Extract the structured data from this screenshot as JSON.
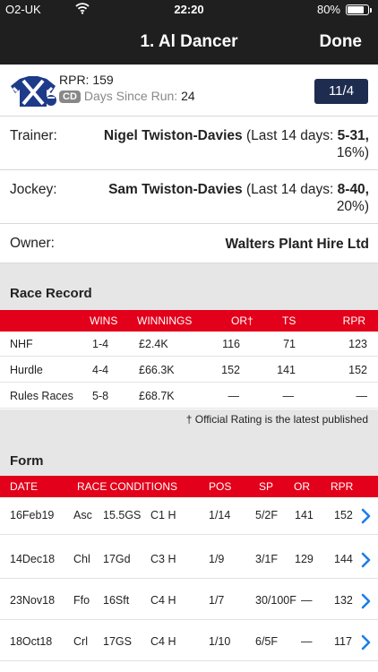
{
  "status_bar": {
    "carrier": "O2-UK",
    "time": "22:20",
    "battery": "80%",
    "battery_level": 0.8
  },
  "nav": {
    "title": "1. Al Dancer",
    "done_label": "Done"
  },
  "runner": {
    "rpr_text": "RPR: 159",
    "cd_badge": "CD",
    "dsr_label": "Days Since Run:",
    "dsr_value": "24",
    "odds": "11/4"
  },
  "details": {
    "trainer_label": "Trainer:",
    "trainer_name": "Nigel Twiston-Davies",
    "trainer_stats_prefix": "(Last 14 days: ",
    "trainer_stats": "5-31,",
    "trainer_pct": "16%)",
    "jockey_label": "Jockey:",
    "jockey_name": "Sam Twiston-Davies",
    "jockey_stats_prefix": "(Last 14 days: ",
    "jockey_stats": "8-40,",
    "jockey_pct": "20%)",
    "owner_label": "Owner:",
    "owner_name": "Walters Plant Hire Ltd"
  },
  "race_record": {
    "title": "Race Record",
    "headers": [
      "WINS",
      "WINNINGS",
      "OR†",
      "TS",
      "RPR"
    ],
    "rows": [
      [
        "NHF",
        "1-4",
        "£2.4K",
        "116",
        "71",
        "123"
      ],
      [
        "Hurdle",
        "4-4",
        "£66.3K",
        "152",
        "141",
        "152"
      ],
      [
        "Rules Races",
        "5-8",
        "£68.7K",
        "—",
        "—",
        "—"
      ]
    ],
    "footnote": "† Official Rating is the latest published"
  },
  "form": {
    "title": "Form",
    "headers": [
      "DATE",
      "RACE CONDITIONS",
      "POS",
      "SP",
      "OR",
      "RPR"
    ],
    "rows": [
      [
        "16Feb19",
        "Asc",
        "15.5GS",
        "C1 H",
        "1/14",
        "5/2F",
        "141",
        "152"
      ],
      [
        "14Dec18",
        "Chl",
        "17Gd",
        "C3 H",
        "1/9",
        "3/1F",
        "129",
        "144"
      ],
      [
        "23Nov18",
        "Ffo",
        "16Sft",
        "C4 H",
        "1/7",
        "30/100F",
        "—",
        "132"
      ],
      [
        "18Oct18",
        "Crl",
        "17GS",
        "C4 H",
        "1/10",
        "6/5F",
        "—",
        "117"
      ]
    ]
  }
}
